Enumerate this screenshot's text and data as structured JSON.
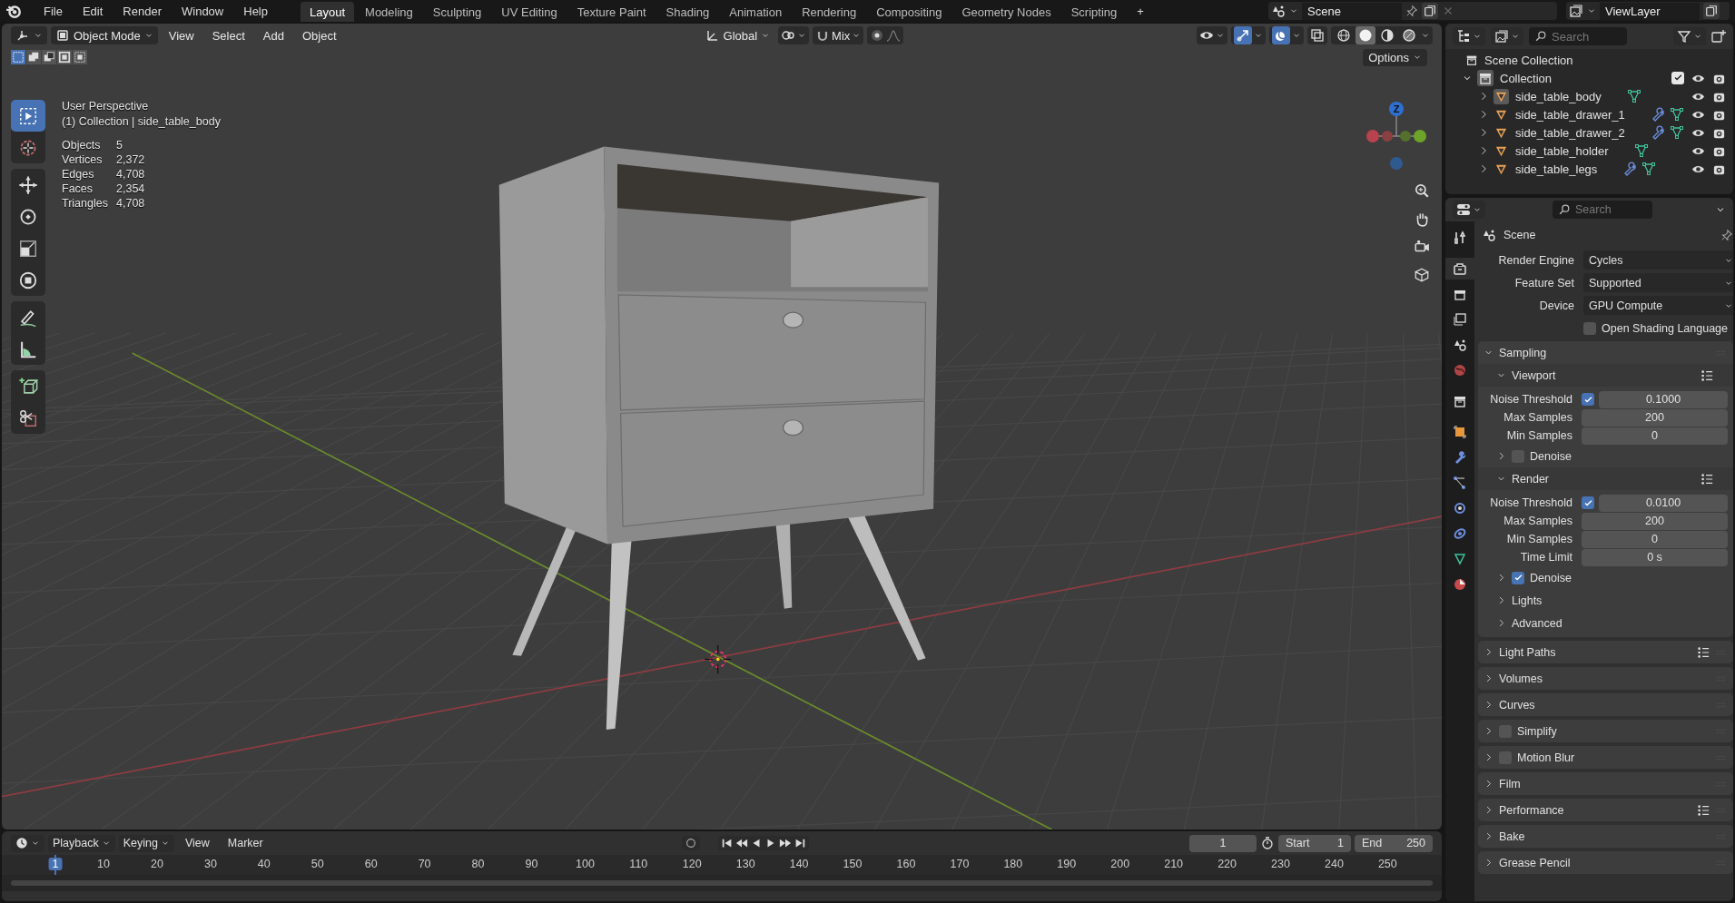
{
  "topbar": {
    "menus": [
      "File",
      "Edit",
      "Render",
      "Window",
      "Help"
    ],
    "workspaces": [
      {
        "label": "Layout",
        "selected": true
      },
      {
        "label": "Modeling",
        "selected": false
      },
      {
        "label": "Sculpting",
        "selected": false
      },
      {
        "label": "UV Editing",
        "selected": false
      },
      {
        "label": "Texture Paint",
        "selected": false
      },
      {
        "label": "Shading",
        "selected": false
      },
      {
        "label": "Animation",
        "selected": false
      },
      {
        "label": "Rendering",
        "selected": false
      },
      {
        "label": "Compositing",
        "selected": false
      },
      {
        "label": "Geometry Nodes",
        "selected": false
      },
      {
        "label": "Scripting",
        "selected": false
      }
    ],
    "add_workspace": "+",
    "scene": "Scene",
    "view_layer": "ViewLayer"
  },
  "viewport": {
    "mode": "Object Mode",
    "menus": [
      "View",
      "Select",
      "Add",
      "Object"
    ],
    "orientation": "Global",
    "snap_target": "Mix",
    "gizmos_on": true,
    "overlays_on": true,
    "shading": [
      {
        "kind": "wireframe",
        "selected": false
      },
      {
        "kind": "solid",
        "selected": true
      },
      {
        "kind": "material",
        "selected": false
      },
      {
        "kind": "rendered",
        "selected": false
      }
    ],
    "select_modes": [
      {
        "kind": "set",
        "selected": true
      },
      {
        "kind": "extend",
        "selected": false
      },
      {
        "kind": "subtract",
        "selected": false
      },
      {
        "kind": "invert",
        "selected": false
      },
      {
        "kind": "intersect",
        "selected": false
      }
    ],
    "options": "Options",
    "toolbar": [
      [
        {
          "kind": "select_box",
          "selected": true
        },
        {
          "kind": "cursor",
          "selected": false
        }
      ],
      [
        {
          "kind": "move",
          "selected": false
        },
        {
          "kind": "rotate",
          "selected": false
        },
        {
          "kind": "scale",
          "selected": false
        },
        {
          "kind": "transform",
          "selected": false
        }
      ],
      [
        {
          "kind": "annotate",
          "selected": false
        },
        {
          "kind": "measure",
          "selected": false
        }
      ],
      [
        {
          "kind": "add_cube",
          "selected": false
        },
        {
          "kind": "cut",
          "selected": false
        }
      ]
    ],
    "view_name": "User Perspective",
    "context": "(1) Collection | side_table_body",
    "stats": [
      {
        "label": "Objects",
        "value": "5"
      },
      {
        "label": "Vertices",
        "value": "2,372"
      },
      {
        "label": "Edges",
        "value": "4,708"
      },
      {
        "label": "Faces",
        "value": "2,354"
      },
      {
        "label": "Triangles",
        "value": "4,708"
      }
    ],
    "gizmo_label": "Z"
  },
  "outliner": {
    "search_placeholder": "Search",
    "root": "Scene Collection",
    "collections": [
      {
        "label": "Collection",
        "expanded": true,
        "checked": true,
        "children": [
          {
            "label": "side_table_body",
            "active": true,
            "modifier": false
          },
          {
            "label": "side_table_drawer_1",
            "active": false,
            "modifier": true
          },
          {
            "label": "side_table_drawer_2",
            "active": false,
            "modifier": true
          },
          {
            "label": "side_table_holder",
            "active": false,
            "modifier": false
          },
          {
            "label": "side_table_legs",
            "active": false,
            "modifier": true
          }
        ]
      }
    ]
  },
  "properties": {
    "search_placeholder": "Search",
    "tabs": [
      {
        "kind": "tool",
        "selected": false
      },
      {
        "kind": "render",
        "selected": true
      },
      {
        "kind": "output",
        "selected": false
      },
      {
        "kind": "view_layer",
        "selected": false
      },
      {
        "kind": "scene",
        "selected": false
      },
      {
        "kind": "world",
        "selected": false
      },
      {
        "kind": "collection",
        "selected": false
      },
      {
        "kind": "object",
        "selected": false
      },
      {
        "kind": "modifiers",
        "selected": false
      },
      {
        "kind": "particles",
        "selected": false
      },
      {
        "kind": "physics",
        "selected": false
      },
      {
        "kind": "constraints",
        "selected": false
      },
      {
        "kind": "data",
        "selected": false
      },
      {
        "kind": "material",
        "selected": false
      }
    ],
    "context": "Scene",
    "fields": [
      {
        "label": "Render Engine",
        "value": "Cycles"
      },
      {
        "label": "Feature Set",
        "value": "Supported"
      },
      {
        "label": "Device",
        "value": "GPU Compute"
      }
    ],
    "osl": {
      "label": "Open Shading Language",
      "checked": false
    },
    "panels": [
      {
        "label": "Sampling",
        "expanded": true,
        "items": [
          {
            "kind": "subpanel",
            "label": "Viewport",
            "expanded": true,
            "presets": true
          },
          {
            "kind": "number",
            "label": "Noise Threshold",
            "value": "0.1000",
            "checked": true
          },
          {
            "kind": "number",
            "label": "Max Samples",
            "value": "200"
          },
          {
            "kind": "number",
            "label": "Min Samples",
            "value": "0"
          },
          {
            "kind": "subpanel",
            "label": "Denoise",
            "expanded": false,
            "checked": false
          },
          {
            "kind": "subpanel",
            "label": "Render",
            "expanded": true,
            "presets": true
          },
          {
            "kind": "number",
            "label": "Noise Threshold",
            "value": "0.0100",
            "checked": true
          },
          {
            "kind": "number",
            "label": "Max Samples",
            "value": "200"
          },
          {
            "kind": "number",
            "label": "Min Samples",
            "value": "0"
          },
          {
            "kind": "number",
            "label": "Time Limit",
            "value": "0 s"
          },
          {
            "kind": "subpanel",
            "label": "Denoise",
            "expanded": false,
            "checked": true
          },
          {
            "kind": "subpanel",
            "label": "Lights",
            "expanded": false
          },
          {
            "kind": "subpanel",
            "label": "Advanced",
            "expanded": false
          }
        ]
      },
      {
        "label": "Light Paths",
        "expanded": false,
        "presets": true
      },
      {
        "label": "Volumes",
        "expanded": false
      },
      {
        "label": "Curves",
        "expanded": false
      },
      {
        "label": "Simplify",
        "expanded": false,
        "checked": false
      },
      {
        "label": "Motion Blur",
        "expanded": false,
        "checked": false
      },
      {
        "label": "Film",
        "expanded": false
      },
      {
        "label": "Performance",
        "expanded": false,
        "presets": true
      },
      {
        "label": "Bake",
        "expanded": false
      },
      {
        "label": "Grease Pencil",
        "expanded": false
      }
    ]
  },
  "timeline": {
    "menus": [
      {
        "label": "Playback",
        "kind": "dropdown"
      },
      {
        "label": "Keying",
        "kind": "dropdown"
      },
      {
        "label": "View",
        "kind": "menu"
      },
      {
        "label": "Marker",
        "kind": "menu"
      }
    ],
    "auto_keying": false,
    "current_frame": "1",
    "start_label": "Start",
    "start": "1",
    "end_label": "End",
    "end": "250",
    "ruler": [
      {
        "label": "1",
        "selected": true
      },
      {
        "label": "10",
        "selected": false
      },
      {
        "label": "20",
        "selected": false
      },
      {
        "label": "30",
        "selected": false
      },
      {
        "label": "40",
        "selected": false
      },
      {
        "label": "50",
        "selected": false
      },
      {
        "label": "60",
        "selected": false
      },
      {
        "label": "70",
        "selected": false
      },
      {
        "label": "80",
        "selected": false
      },
      {
        "label": "90",
        "selected": false
      },
      {
        "label": "100",
        "selected": false
      },
      {
        "label": "110",
        "selected": false
      },
      {
        "label": "120",
        "selected": false
      },
      {
        "label": "130",
        "selected": false
      },
      {
        "label": "140",
        "selected": false
      },
      {
        "label": "150",
        "selected": false
      },
      {
        "label": "160",
        "selected": false
      },
      {
        "label": "170",
        "selected": false
      },
      {
        "label": "180",
        "selected": false
      },
      {
        "label": "190",
        "selected": false
      },
      {
        "label": "200",
        "selected": false
      },
      {
        "label": "210",
        "selected": false
      },
      {
        "label": "220",
        "selected": false
      },
      {
        "label": "230",
        "selected": false
      },
      {
        "label": "240",
        "selected": false
      },
      {
        "label": "250",
        "selected": false
      }
    ]
  }
}
